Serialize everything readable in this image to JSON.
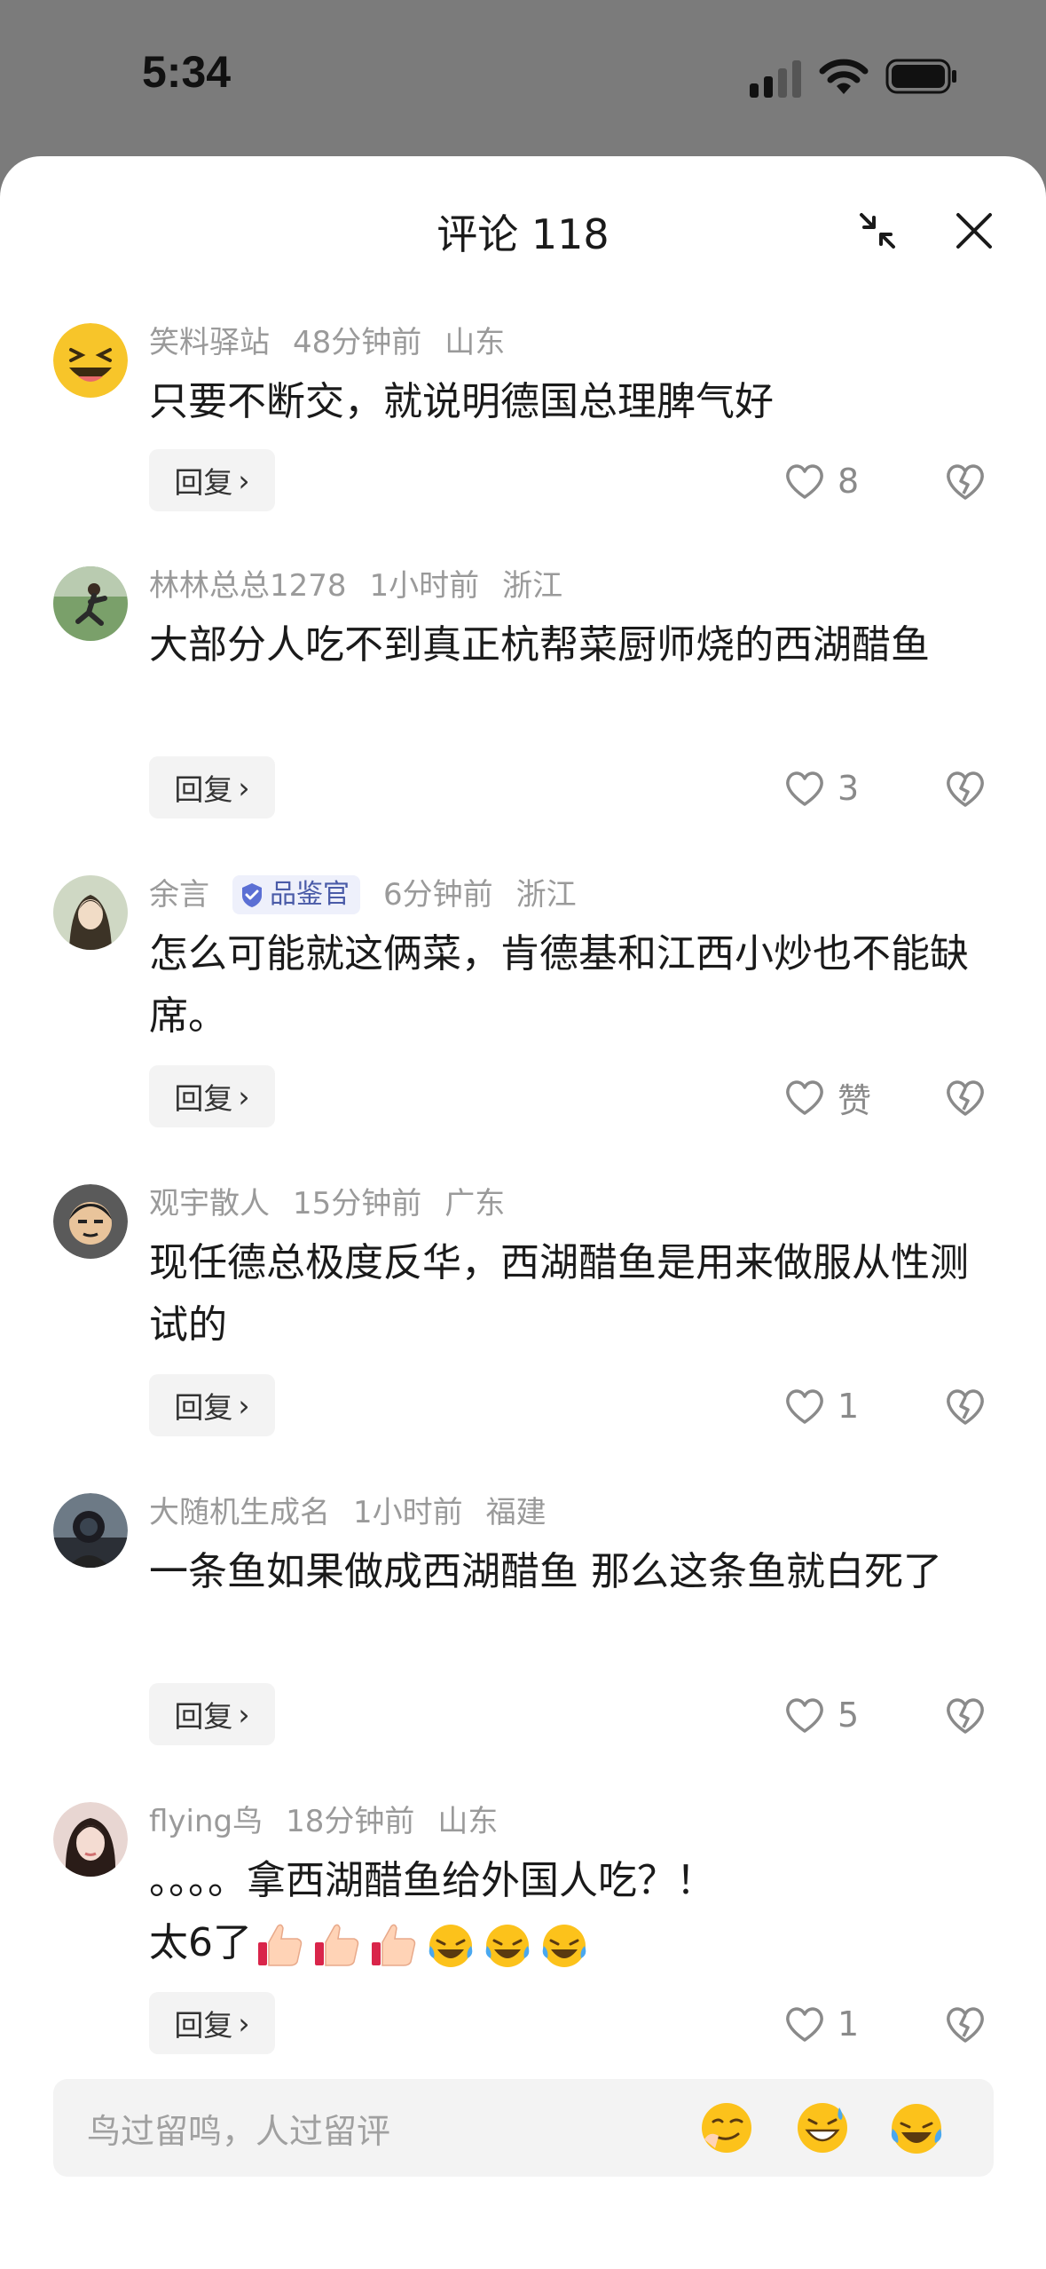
{
  "status_bar": {
    "time": "5:34"
  },
  "header": {
    "title": "评论 118"
  },
  "reply_label": "回复",
  "comments": [
    {
      "user": "笑料驿站",
      "time": "48分钟前",
      "location": "山东",
      "text": "只要不断交，就说明德国总理脾气好",
      "likes": "8"
    },
    {
      "user": "林林总总1278",
      "time": "1小时前",
      "location": "浙江",
      "text": "大部分人吃不到真正杭帮菜厨师烧的西湖醋鱼",
      "likes": "3"
    },
    {
      "user": "余言",
      "badge": "品鉴官",
      "time": "6分钟前",
      "location": "浙江",
      "text": "怎么可能就这俩菜，肯德基和江西小炒也不能缺席。",
      "likes": "赞"
    },
    {
      "user": "观宇散人",
      "time": "15分钟前",
      "location": "广东",
      "text": "现任德总极度反华，西湖醋鱼是用来做服从性测试的",
      "likes": "1"
    },
    {
      "user": "大随机生成名",
      "time": "1小时前",
      "location": "福建",
      "text": "一条鱼如果做成西湖醋鱼 那么这条鱼就白死了",
      "likes": "5"
    },
    {
      "user": "flying鸟",
      "time": "18分钟前",
      "location": "山东",
      "text_line1": "。。。。拿西湖醋鱼给外国人吃？！",
      "text_line2": "太6了",
      "likes": "1"
    }
  ],
  "input": {
    "placeholder": "鸟过留鸣，人过留评"
  }
}
